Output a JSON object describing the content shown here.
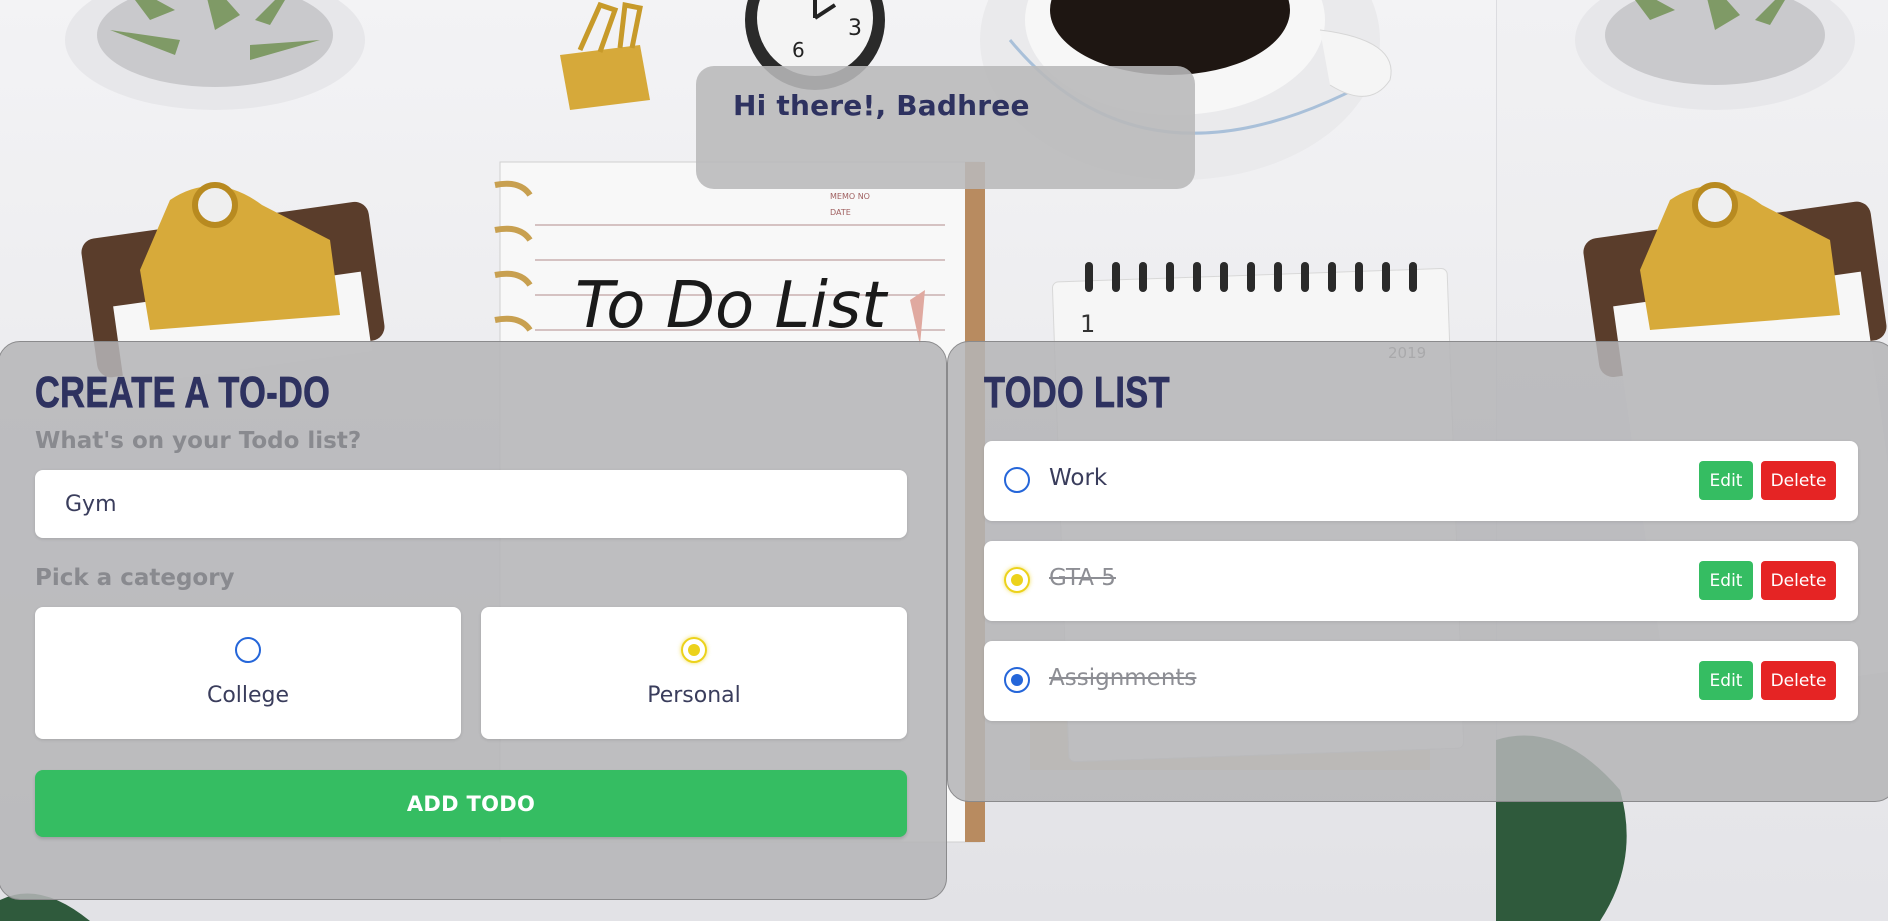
{
  "greeting": {
    "text": "Hi there!, Badhree"
  },
  "create_panel": {
    "title": "CREATE A TO-DO",
    "todo_label": "What's on your Todo list?",
    "todo_input_value": "Gym",
    "category_label": "Pick a category",
    "categories": [
      {
        "label": "College",
        "color": "#2566d9",
        "selected": false
      },
      {
        "label": "Personal",
        "color": "#ecd21b",
        "selected": true
      }
    ],
    "add_button_label": "ADD TODO"
  },
  "list_panel": {
    "title": "TODO LIST",
    "items": [
      {
        "text": "Work",
        "category_color": "#2566d9",
        "done": false
      },
      {
        "text": "GTA 5",
        "category_color": "#ecd21b",
        "done": true
      },
      {
        "text": "Assignments",
        "category_color": "#2566d9",
        "done": true
      }
    ],
    "edit_label": "Edit",
    "delete_label": "Delete"
  },
  "background": {
    "notebook_text": "To Do List",
    "notebook_memo": "MEMO NO",
    "notebook_date": "DATE",
    "calendar_day": "1",
    "calendar_year": "2019"
  },
  "colors": {
    "accent_green": "#35bd62",
    "danger_red": "#e52424",
    "heading_navy": "#2e3260"
  }
}
